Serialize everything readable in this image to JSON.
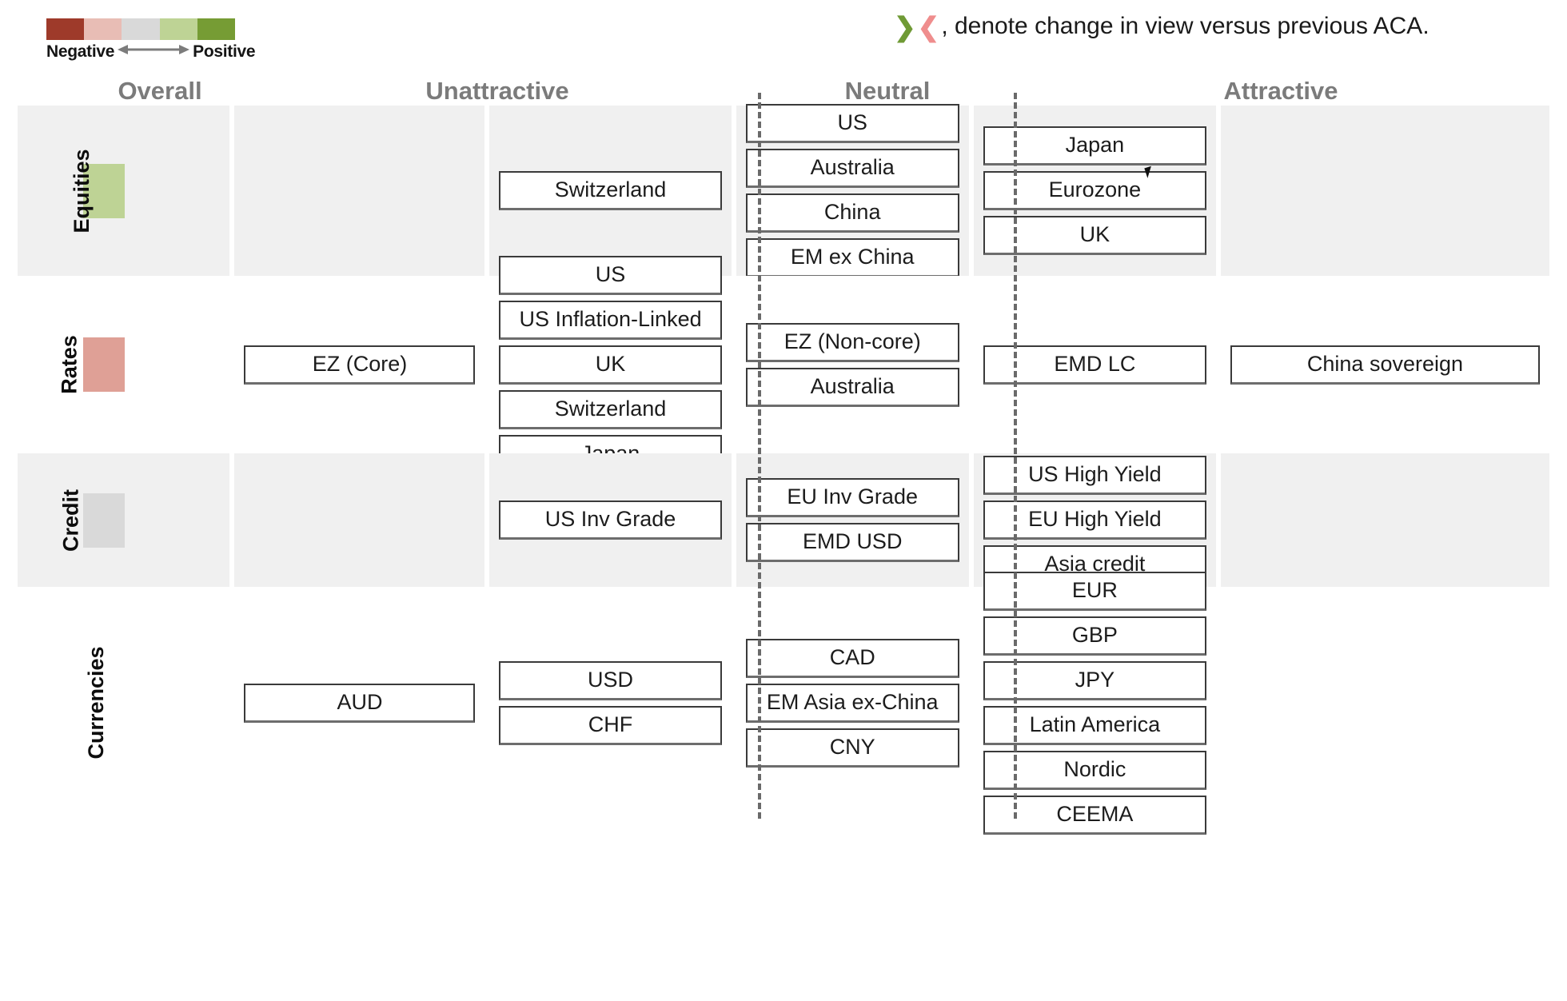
{
  "scale_legend": {
    "negative_label": "Negative",
    "positive_label": "Positive",
    "arrow_icon": "double-headed-arrow",
    "swatches": [
      "#9e3a2a",
      "#e8bdb5",
      "#d9d9d9",
      "#bed395",
      "#769c34"
    ]
  },
  "change_legend": {
    "up_chevron": "❯",
    "down_chevron": "❮",
    "note": ", denote change in view versus previous ACA.",
    "up_color": "#6f9a35",
    "down_color": "#ef8d8d"
  },
  "columns": [
    {
      "key": "overall",
      "label": "Overall"
    },
    {
      "key": "unattractive",
      "label": "Unattractive"
    },
    {
      "key": "neutral",
      "label": "Neutral"
    },
    {
      "key": "attractive",
      "label": "Attractive"
    }
  ],
  "rows": [
    {
      "label": "Equities",
      "shaded": true,
      "overall_color": "#bed395",
      "gap1": [],
      "unattractive": [
        "Switzerland"
      ],
      "neutral": [
        "US",
        "Australia",
        "China",
        "EM ex China"
      ],
      "attractive": [
        "Japan",
        "Eurozone",
        "UK"
      ],
      "gap2": []
    },
    {
      "label": "Rates",
      "shaded": false,
      "overall_color": "#dfa096",
      "gap1": [
        "EZ (Core)"
      ],
      "unattractive": [
        "US",
        "US Inflation-Linked",
        "UK",
        "Switzerland",
        "Japan"
      ],
      "neutral": [
        "EZ (Non-core)",
        "Australia"
      ],
      "attractive": [
        "EMD LC"
      ],
      "gap2": [
        "China sovereign"
      ]
    },
    {
      "label": "Credit",
      "shaded": true,
      "overall_color": "#d9d9d9",
      "gap1": [],
      "unattractive": [
        "US Inv Grade"
      ],
      "neutral": [
        "EU Inv Grade",
        "EMD USD"
      ],
      "attractive": [
        "US High Yield",
        "EU High Yield",
        "Asia credit"
      ],
      "gap2": []
    },
    {
      "label": "Currencies",
      "shaded": false,
      "overall_color": null,
      "gap1": [
        "AUD"
      ],
      "unattractive": [
        "USD",
        "CHF"
      ],
      "neutral": [
        "CAD",
        "EM Asia ex-China",
        "CNY"
      ],
      "attractive": [
        "EUR",
        "GBP",
        "JPY",
        "Latin America",
        "Nordic",
        "CEEMA"
      ],
      "gap2": []
    }
  ]
}
